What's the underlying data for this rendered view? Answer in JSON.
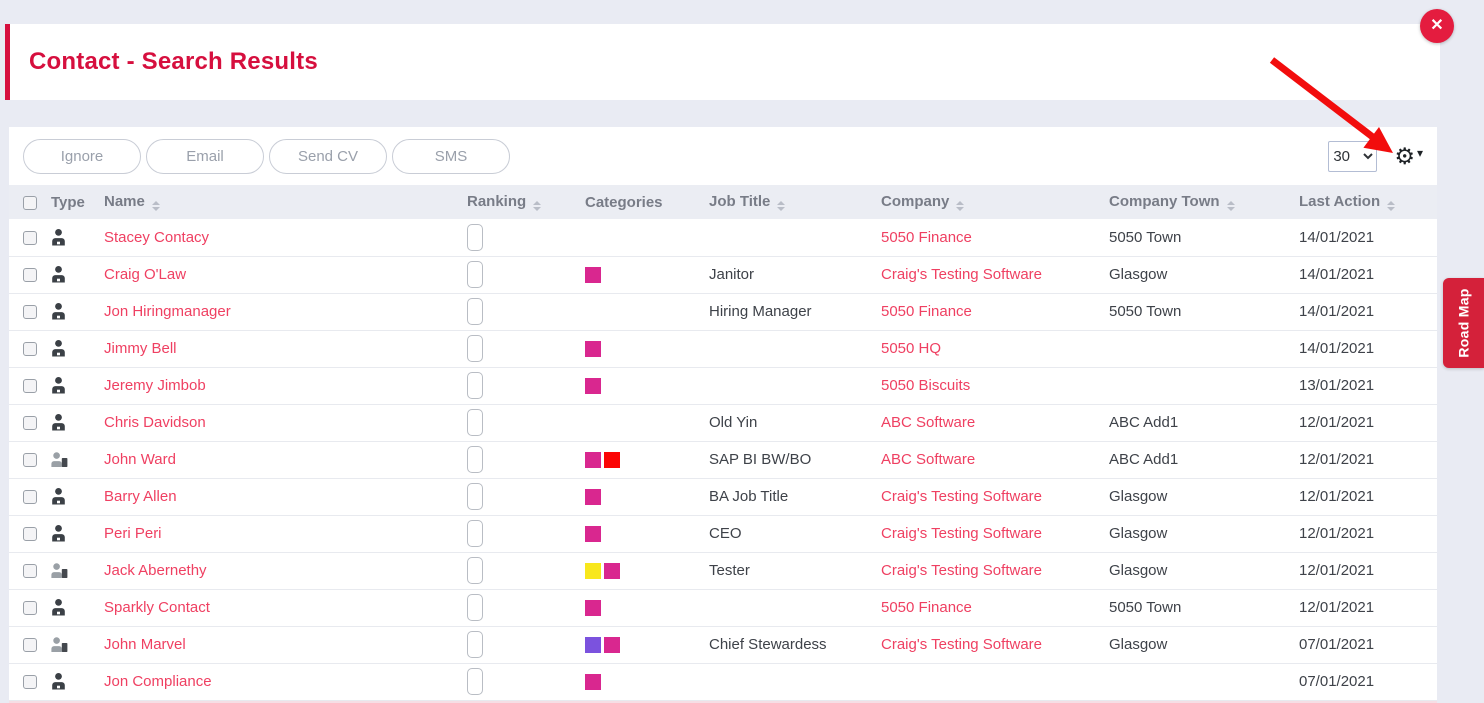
{
  "page": {
    "title": "Contact - Search Results",
    "close_icon": "✕"
  },
  "toolbar": {
    "buttons": [
      "Ignore",
      "Email",
      "Send CV",
      "SMS"
    ],
    "page_size": "30",
    "gear_icon": "⚙",
    "caret_icon": "▾"
  },
  "road_map": {
    "label": "Road Map"
  },
  "annotation": {
    "arrow_color": "#f20d0d"
  },
  "category_colors": {
    "magenta": "#d9278f",
    "red": "#fb0505",
    "yellow": "#f8e71c",
    "purple": "#7b52de"
  },
  "table": {
    "columns": [
      {
        "label": "",
        "sortable": false
      },
      {
        "label": "Type",
        "sortable": false
      },
      {
        "label": "Name",
        "sortable": true
      },
      {
        "label": "Ranking",
        "sortable": true
      },
      {
        "label": "Categories",
        "sortable": false
      },
      {
        "label": "Job Title",
        "sortable": true
      },
      {
        "label": "Company",
        "sortable": true
      },
      {
        "label": "Company Town",
        "sortable": true
      },
      {
        "label": "Last Action",
        "sortable": true
      }
    ],
    "rows": [
      {
        "type": "contact",
        "name": "Stacey Contacy",
        "categories": [],
        "job_title": "",
        "company": "5050 Finance",
        "company_town": "5050 Town",
        "last_action": "14/01/2021"
      },
      {
        "type": "contact",
        "name": "Craig O'Law",
        "categories": [
          "magenta"
        ],
        "job_title": "Janitor",
        "company": "Craig's Testing Software",
        "company_town": "Glasgow",
        "last_action": "14/01/2021"
      },
      {
        "type": "contact",
        "name": "Jon Hiringmanager",
        "categories": [],
        "job_title": "Hiring Manager",
        "company": "5050 Finance",
        "company_town": "5050 Town",
        "last_action": "14/01/2021"
      },
      {
        "type": "contact",
        "name": "Jimmy Bell",
        "categories": [
          "magenta"
        ],
        "job_title": "",
        "company": "5050 HQ",
        "company_town": "",
        "last_action": "14/01/2021"
      },
      {
        "type": "contact",
        "name": "Jeremy Jimbob",
        "categories": [
          "magenta"
        ],
        "job_title": "",
        "company": "5050 Biscuits",
        "company_town": "",
        "last_action": "13/01/2021"
      },
      {
        "type": "contact",
        "name": "Chris Davidson",
        "categories": [],
        "job_title": "Old Yin",
        "company": "ABC Software",
        "company_town": "ABC Add1",
        "last_action": "12/01/2021"
      },
      {
        "type": "contact-candidate",
        "name": "John Ward",
        "categories": [
          "magenta",
          "red"
        ],
        "job_title": "SAP BI BW/BO",
        "company": "ABC Software",
        "company_town": "ABC Add1",
        "last_action": "12/01/2021"
      },
      {
        "type": "contact",
        "name": "Barry Allen",
        "categories": [
          "magenta"
        ],
        "job_title": "BA Job Title",
        "company": "Craig's Testing Software",
        "company_town": "Glasgow",
        "last_action": "12/01/2021"
      },
      {
        "type": "contact",
        "name": "Peri Peri",
        "categories": [
          "magenta"
        ],
        "job_title": "CEO",
        "company": "Craig's Testing Software",
        "company_town": "Glasgow",
        "last_action": "12/01/2021"
      },
      {
        "type": "contact-candidate",
        "name": "Jack Abernethy",
        "categories": [
          "yellow",
          "magenta"
        ],
        "job_title": "Tester",
        "company": "Craig's Testing Software",
        "company_town": "Glasgow",
        "last_action": "12/01/2021"
      },
      {
        "type": "contact",
        "name": "Sparkly Contact",
        "categories": [
          "magenta"
        ],
        "job_title": "",
        "company": "5050 Finance",
        "company_town": "5050 Town",
        "last_action": "12/01/2021"
      },
      {
        "type": "contact-candidate",
        "name": "John Marvel",
        "categories": [
          "purple",
          "magenta"
        ],
        "job_title": "Chief Stewardess",
        "company": "Craig's Testing Software",
        "company_town": "Glasgow",
        "last_action": "07/01/2021"
      },
      {
        "type": "contact",
        "name": "Jon Compliance",
        "categories": [
          "magenta"
        ],
        "job_title": "",
        "company": "",
        "company_town": "",
        "last_action": "07/01/2021"
      }
    ]
  }
}
